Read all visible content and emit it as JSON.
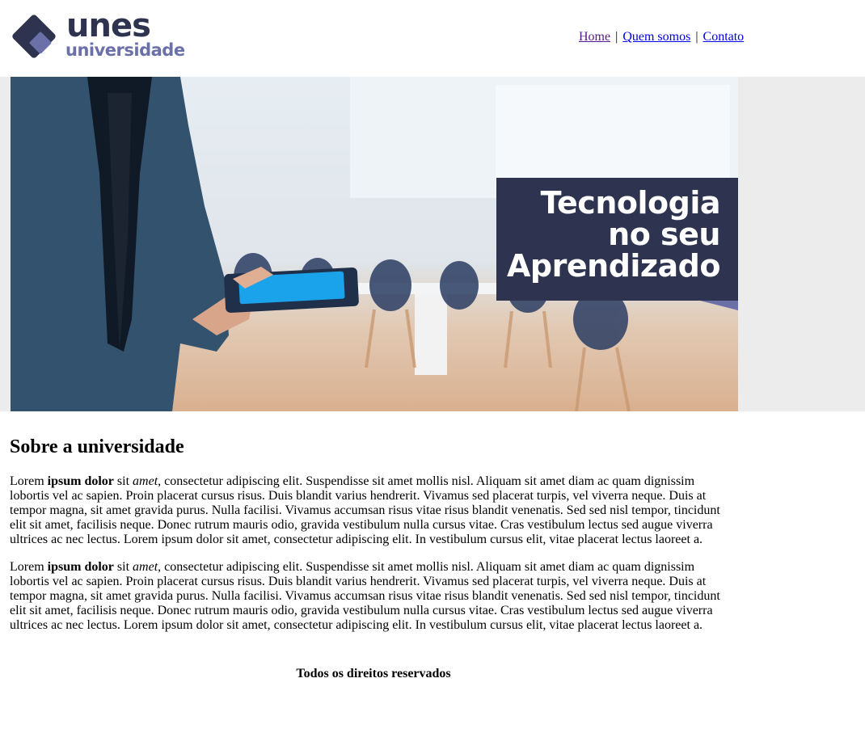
{
  "brand": {
    "name": "unes",
    "subtitle": "universidade",
    "colors": {
      "dark": "#2e3350",
      "accent": "#6b70a8"
    }
  },
  "nav": {
    "items": [
      {
        "label": "Home",
        "visited": true
      },
      {
        "label": "Quem somos",
        "visited": false
      },
      {
        "label": "Contato",
        "visited": false
      }
    ],
    "separator": "|"
  },
  "banner": {
    "tagline_lines": [
      "Tecnologia",
      "no seu",
      "Aprendizado"
    ],
    "image_subject": "man-holding-tablet-in-meeting-room"
  },
  "about": {
    "heading": "Sobre a universidade",
    "paragraphs": [
      {
        "lead": "Lorem ",
        "bold": "ipsum dolor",
        "mid": " sit ",
        "italic": "amet",
        "rest": ", consectetur adipiscing elit. Suspendisse sit amet mollis nisl. Aliquam sit amet diam ac quam dignissim lobortis vel ac sapien. Proin placerat cursus risus. Duis blandit varius hendrerit. Vivamus sed placerat turpis, vel viverra neque. Duis at tempor magna, sit amet gravida purus. Nulla facilisi. Vivamus accumsan risus vitae risus blandit venenatis. Sed sed nisl tempor, tincidunt elit sit amet, facilisis neque. Donec rutrum mauris odio, gravida vestibulum nulla cursus vitae. Cras vestibulum lectus sed augue viverra ultrices ac nec lectus. Lorem ipsum dolor sit amet, consectetur adipiscing elit. In vestibulum cursus elit, vitae placerat lectus laoreet a."
      },
      {
        "lead": "Lorem ",
        "bold": "ipsum dolor",
        "mid": " sit ",
        "italic": "amet",
        "rest": ", consectetur adipiscing elit. Suspendisse sit amet mollis nisl. Aliquam sit amet diam ac quam dignissim lobortis vel ac sapien. Proin placerat cursus risus. Duis blandit varius hendrerit. Vivamus sed placerat turpis, vel viverra neque. Duis at tempor magna, sit amet gravida purus. Nulla facilisi. Vivamus accumsan risus vitae risus blandit venenatis. Sed sed nisl tempor, tincidunt elit sit amet, facilisis neque. Donec rutrum mauris odio, gravida vestibulum nulla cursus vitae. Cras vestibulum lectus sed augue viverra ultrices ac nec lectus. Lorem ipsum dolor sit amet, consectetur adipiscing elit. In vestibulum cursus elit, vitae placerat lectus laoreet a."
      }
    ]
  },
  "footer": {
    "text": "Todos os direitos reservados"
  }
}
